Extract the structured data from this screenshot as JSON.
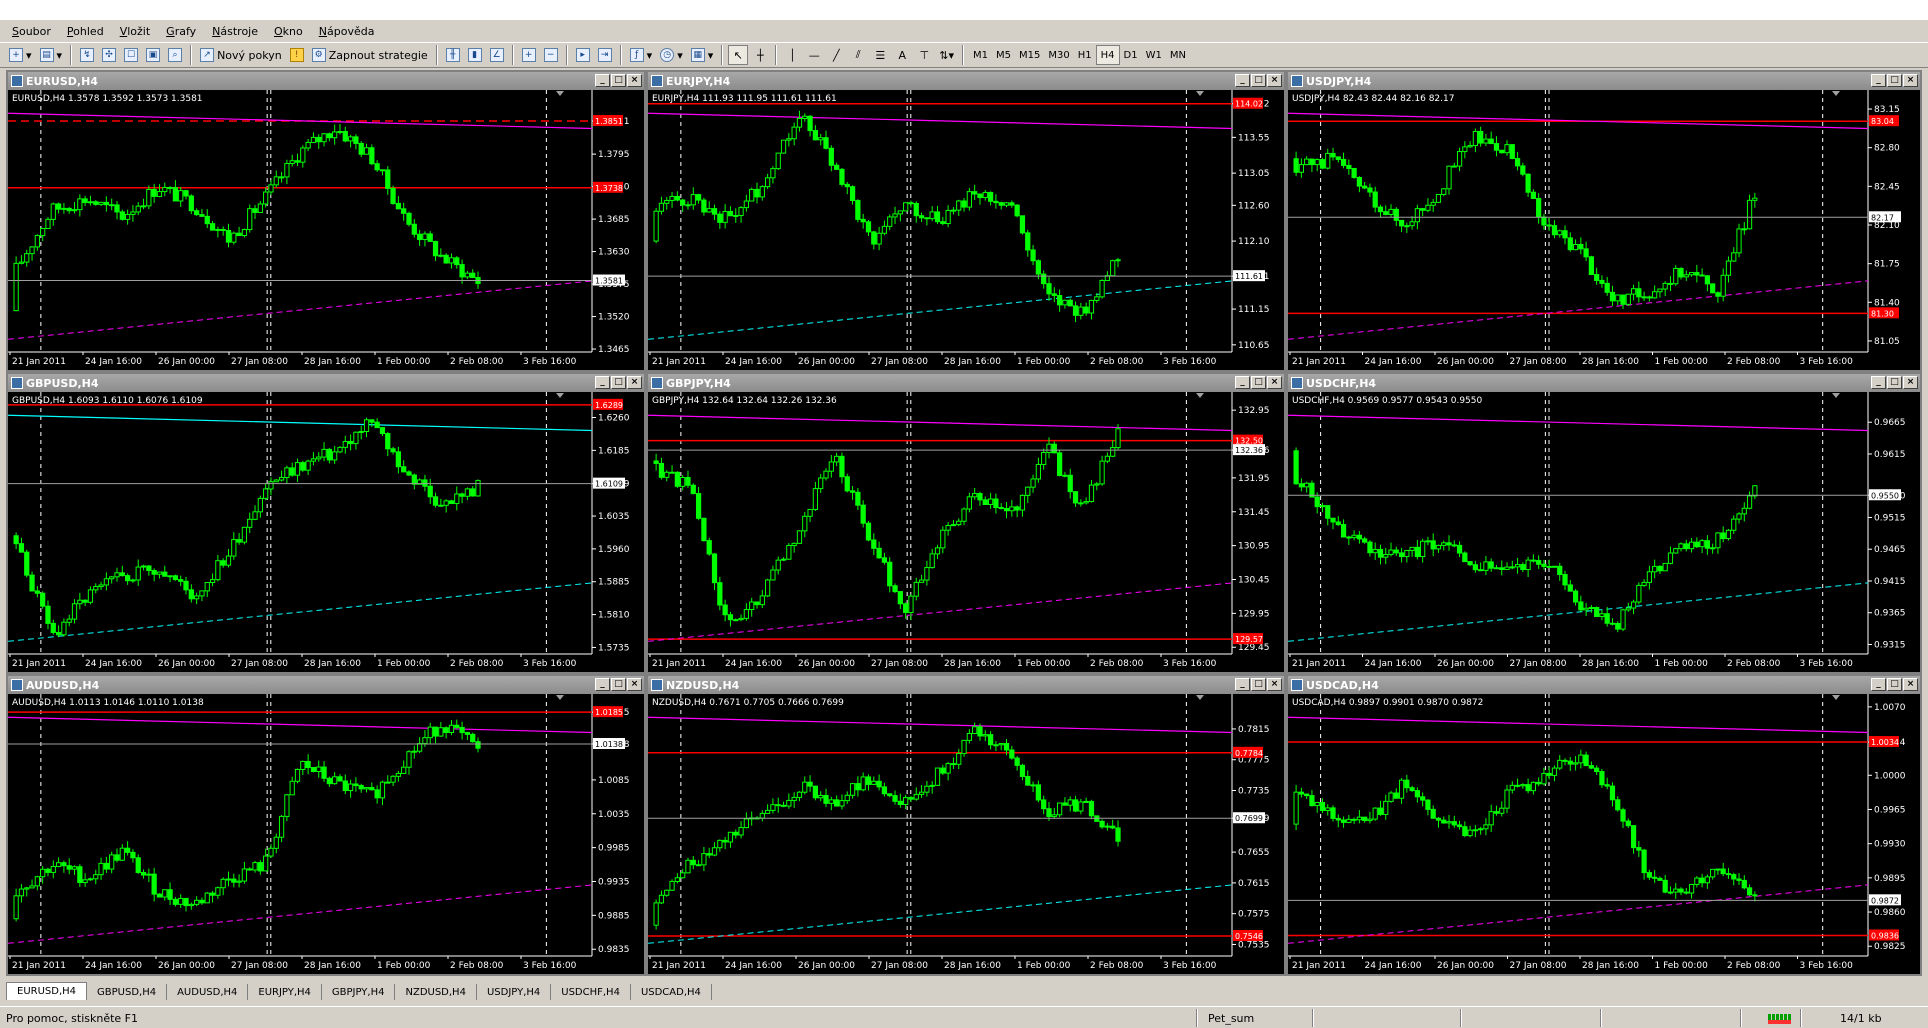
{
  "menu": [
    "Soubor",
    "Pohled",
    "Vložit",
    "Grafy",
    "Nástroje",
    "Okno",
    "Nápověda"
  ],
  "toolbar": {
    "new_order_label": "Nový pokyn",
    "strategy_label": "Zapnout strategie",
    "timeframes": [
      "M1",
      "M5",
      "M15",
      "M30",
      "H1",
      "H4",
      "D1",
      "W1",
      "MN"
    ],
    "active_timeframe": "H4",
    "text_tool": "A",
    "tools": [
      "new-chart-icon",
      "profiles-icon",
      "market-watch-icon",
      "navigator-icon",
      "terminal-icon",
      "tester-icon",
      "autotrading-icon",
      "bar-chart-icon",
      "candle-chart-icon",
      "line-chart-icon",
      "zoom-in-icon",
      "zoom-out-icon",
      "auto-scroll-icon",
      "chart-shift-icon",
      "indicators-icon",
      "periods-icon",
      "templates-icon",
      "cursor-icon",
      "crosshair-icon",
      "vertical-line-icon",
      "horizontal-line-icon",
      "trendline-icon",
      "channel-icon",
      "fibonacci-icon",
      "text-icon",
      "text-label-icon",
      "arrows-icon"
    ]
  },
  "colors": {
    "bull": "#00ff00",
    "bear": "#00ff00",
    "grid": "#808080",
    "red_line": "#ff0000",
    "cyan": "#00ffff",
    "magenta": "#ff00ff",
    "axis_text": "#ffffff"
  },
  "date_labels": [
    "21 Jan 2011",
    "24 Jan 16:00",
    "26 Jan 00:00",
    "27 Jan 08:00",
    "28 Jan 16:00",
    "1 Feb 00:00",
    "2 Feb 08:00",
    "3 Feb 16:00"
  ],
  "charts": [
    {
      "title": "EURUSD,H4",
      "info": "EURUSD,H4  1.3578 1.3592 1.3573 1.3581",
      "ymin": 1.346,
      "ymax": 1.389,
      "ticks": [
        "1.3465",
        "1.3520",
        "1.3575",
        "1.3630",
        "1.3685",
        "1.3740",
        "1.3795",
        "1.3851"
      ],
      "price": "1.3581",
      "red": [
        "1.3851",
        "1.3738"
      ],
      "start": 1.353,
      "path": [
        1.36,
        1.37,
        1.372,
        1.369,
        1.374,
        1.371,
        1.365,
        1.372,
        1.38,
        1.384,
        1.379,
        1.368,
        1.362,
        1.358
      ]
    },
    {
      "title": "EURJPY,H4",
      "info": "EURJPY,H4  111.93 111.95 111.61 111.61",
      "ymin": 110.55,
      "ymax": 114.1,
      "ticks": [
        "110.65",
        "111.15",
        "111.61",
        "112.10",
        "112.60",
        "113.05",
        "113.55",
        "114.02"
      ],
      "price": "111.61",
      "red": [
        "114.02"
      ],
      "start": 112.1,
      "path": [
        112.6,
        112.7,
        112.4,
        112.9,
        113.9,
        113.2,
        112.1,
        112.6,
        112.4,
        112.8,
        112.6,
        111.3,
        111.1,
        111.9
      ]
    },
    {
      "title": "USDJPY,H4",
      "info": "USDJPY,H4  82.43 82.44 82.16 82.17",
      "ymin": 80.95,
      "ymax": 83.25,
      "ticks": [
        "81.05",
        "81.40",
        "81.75",
        "82.10",
        "82.45",
        "82.80",
        "83.15"
      ],
      "price": "82.17",
      "red": [
        "83.04",
        "81.30"
      ],
      "start": 82.7,
      "path": [
        82.6,
        82.7,
        82.4,
        82.1,
        82.4,
        82.9,
        82.8,
        82.1,
        81.9,
        81.4,
        81.5,
        81.7,
        81.5,
        82.4
      ]
    },
    {
      "title": "GBPUSD,H4",
      "info": "GBPUSD,H4  1.6093 1.6110 1.6076 1.6109",
      "ymin": 1.572,
      "ymax": 1.63,
      "ticks": [
        "1.5735",
        "1.5810",
        "1.5885",
        "1.5960",
        "1.6035",
        "1.6109",
        "1.6185",
        "1.6260"
      ],
      "price": "1.6109",
      "red": [
        "1.6289"
      ],
      "start": 1.599,
      "path": [
        1.597,
        1.576,
        1.585,
        1.59,
        1.592,
        1.585,
        1.595,
        1.61,
        1.615,
        1.618,
        1.625,
        1.613,
        1.606,
        1.61
      ]
    },
    {
      "title": "GBPJPY,H4",
      "info": "GBPJPY,H4  132.64 132.64 132.26 132.36",
      "ymin": 129.35,
      "ymax": 133.1,
      "ticks": [
        "129.45",
        "129.95",
        "130.45",
        "130.95",
        "131.45",
        "131.95",
        "132.36",
        "132.95"
      ],
      "price": "132.36",
      "red": [
        "132.50",
        "129.57"
      ],
      "start": 132.2,
      "path": [
        132.1,
        131.8,
        129.7,
        130.2,
        131.2,
        132.3,
        131.1,
        130.0,
        131.1,
        131.7,
        131.4,
        132.4,
        131.5,
        132.6
      ]
    },
    {
      "title": "USDCHF,H4",
      "info": "USDCHF,H4  0.9569 0.9577 0.9543 0.9550",
      "ymin": 0.93,
      "ymax": 0.97,
      "ticks": [
        "0.9315",
        "0.9365",
        "0.9415",
        "0.9465",
        "0.9515",
        "0.9550",
        "0.9615",
        "0.9665"
      ],
      "price": "0.9550",
      "red": [],
      "start": 0.962,
      "path": [
        0.958,
        0.951,
        0.947,
        0.945,
        0.948,
        0.944,
        0.943,
        0.945,
        0.938,
        0.934,
        0.943,
        0.947,
        0.948,
        0.956
      ]
    },
    {
      "title": "AUDUSD,H4",
      "info": "AUDUSD,H4  1.0113 1.0146 1.0110 1.0138",
      "ymin": 0.9825,
      "ymax": 1.02,
      "ticks": [
        "0.9835",
        "0.9885",
        "0.9935",
        "0.9985",
        "1.0035",
        "1.0085",
        "1.0138",
        "1.0185"
      ],
      "price": "1.0138",
      "red": [
        "1.0185"
      ],
      "start": 0.988,
      "path": [
        0.992,
        0.996,
        0.994,
        0.998,
        0.992,
        0.99,
        0.994,
        0.996,
        1.011,
        1.008,
        1.006,
        1.012,
        1.017,
        1.013
      ]
    },
    {
      "title": "NZDUSD,H4",
      "info": "NZDUSD,H4  0.7671 0.7705 0.7666 0.7699",
      "ymin": 0.752,
      "ymax": 0.785,
      "ticks": [
        "0.7535",
        "0.7575",
        "0.7615",
        "0.7655",
        "0.7699",
        "0.7735",
        "0.7775",
        "0.7815"
      ],
      "price": "0.7699",
      "red": [
        "0.7784",
        "0.7546"
      ],
      "start": 0.756,
      "path": [
        0.759,
        0.764,
        0.768,
        0.77,
        0.774,
        0.772,
        0.775,
        0.772,
        0.776,
        0.781,
        0.778,
        0.771,
        0.772,
        0.767
      ]
    },
    {
      "title": "USDCAD,H4",
      "info": "USDCAD,H4  0.9897 0.9901 0.9870 0.9872",
      "ymin": 0.9815,
      "ymax": 1.0075,
      "ticks": [
        "0.9825",
        "0.9860",
        "0.9895",
        "0.9930",
        "0.9965",
        "1.0000",
        "1.0034",
        "1.0070"
      ],
      "price": "0.9872",
      "red": [
        "1.0034",
        "0.9836"
      ],
      "start": 0.995,
      "path": [
        0.998,
        0.996,
        0.995,
        0.999,
        0.996,
        0.994,
        0.998,
        1.0,
        1.002,
        0.998,
        0.989,
        0.988,
        0.99,
        0.988
      ]
    }
  ],
  "tabs": [
    "EURUSD,H4",
    "GBPUSD,H4",
    "AUDUSD,H4",
    "EURJPY,H4",
    "GBPJPY,H4",
    "NZDUSD,H4",
    "USDJPY,H4",
    "USDCHF,H4",
    "USDCAD,H4"
  ],
  "active_tab": "EURUSD,H4",
  "status": {
    "help": "Pro pomoc, stiskněte F1",
    "profile": "Pet_sum",
    "traffic": "14/1 kb"
  }
}
